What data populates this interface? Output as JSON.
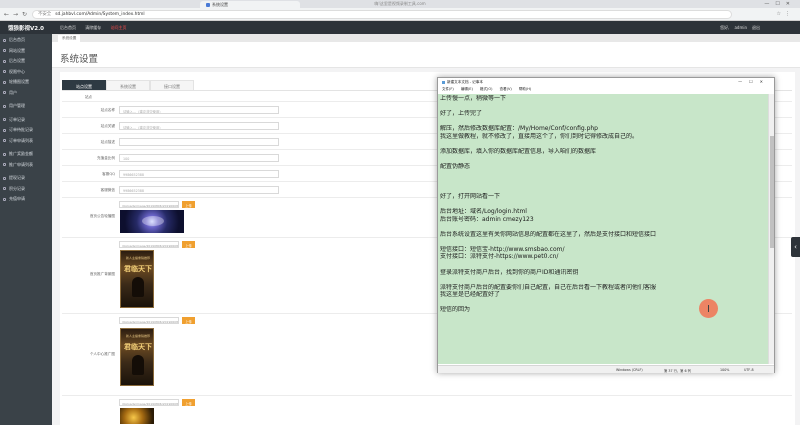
{
  "browser": {
    "tab_title": "系统设置",
    "window_title": "嗨!这里是视频录制工具.com",
    "security_label": "不安全",
    "url": "sd.jahbvl.com/Admin/System_index.html"
  },
  "header": {
    "app_title": "饿狼影视V2.0",
    "nav": [
      "后台首页",
      "清除缓存",
      "访问主页"
    ],
    "user_label": "您好,",
    "user_name": "admin",
    "logout": "退出"
  },
  "sidebar": {
    "items": [
      {
        "label": "后台首页"
      },
      {
        "label": "网站设置"
      },
      {
        "label": "后台设置"
      },
      {
        "label": "权限中心"
      },
      {
        "label": "轮播图设置"
      },
      {
        "label": "用户"
      },
      {
        "label": "用户管理"
      },
      {
        "label": "订单记录"
      },
      {
        "label": "订单待批记录"
      },
      {
        "label": "订单申请列表"
      },
      {
        "label": "推广奖励金额"
      },
      {
        "label": "推广申请列表"
      },
      {
        "label": "提现记录"
      },
      {
        "label": "积分记录"
      },
      {
        "label": "充值申请"
      }
    ]
  },
  "breadcrumb": "系统设置",
  "page_title": "系统设置",
  "tabs": [
    {
      "label": "站点设置",
      "active": true
    },
    {
      "label": "系统设置",
      "active": false
    },
    {
      "label": "接口设置",
      "active": false
    }
  ],
  "form": {
    "section_label": "站点",
    "fields": [
      {
        "label": "站点名称",
        "placeholder": "请输入…（建议非空使用）"
      },
      {
        "label": "站点关键",
        "placeholder": "请输入…（建议非空使用）"
      },
      {
        "label": "站点描述",
        "placeholder": ""
      },
      {
        "label": "充值金比例",
        "placeholder": "100"
      },
      {
        "label": "客服QQ",
        "placeholder": "9986652388"
      },
      {
        "label": "客服微信",
        "placeholder": "9986652388"
      }
    ],
    "uploads": [
      {
        "label": "首页公告轮播图",
        "path": "/Uploads/image/20190806/201906081…",
        "button": "上传"
      },
      {
        "label": "首页推广背景图",
        "path": "/Uploads/image/20190806/201906081…",
        "button": "上传"
      },
      {
        "label": "个人中心推广图",
        "path": "/Uploads/image/20190806/201906081…",
        "button": "上传"
      },
      {
        "label": "",
        "path": "/Uploads/image/20190806/201906081…",
        "button": "上传"
      }
    ],
    "poster_title": "君临天下",
    "poster_subtitle": "新人主播重磅推荐"
  },
  "notepad": {
    "title": "新建文本文档 - 记事本",
    "menu": [
      "文件(F)",
      "编辑(E)",
      "格式(O)",
      "查看(V)",
      "帮助(H)"
    ],
    "lines": [
      "上传慢一点，稍微等一下",
      "",
      "好了，上传完了",
      "",
      "解压，然后修改数据库配置：/My/Home/Conf/config.php",
      "我这里做教程，就不修改了，直接用这个了，你们到时记得修改成自己的。",
      "",
      "添加数据库，填入你的数据库配置信息，导入咱们的数据库",
      "",
      "配置伪静态",
      "",
      "",
      "",
      "好了，打开网站看一下",
      "",
      "后台地址：域名/Log/login.html",
      "后台账号密码：admin  cmezy123",
      "",
      "后台系统设置这里有关你网站信息的配置都在这里了，然后是支付接口和短信接口",
      "",
      "短信接口：短信宝-http://www.smsbao.com/",
      "支付接口：派特支付-https://www.pet0.cn/",
      "",
      "登录派特支付商户后台，找到你的商户ID和通讯密钥",
      "",
      "派特支付商户后台的配置要你们自己配置，自己在后台看一下教程或者问他们客服",
      "我这里是已经配置好了",
      "",
      "短信的回为"
    ],
    "status": {
      "encoding": "Windows (CRLF)",
      "position": "第 37 行，第 6 列",
      "zoom": "100%",
      "charset": "UTF-8"
    }
  },
  "colors": {
    "sidebar_bg": "#3a4248",
    "header_bg": "#2d3339",
    "notepad_bg": "#c8e6c9",
    "accent_upload": "#f0a030",
    "alert_red": "#ff4d4d",
    "cursor_marker": "#f07a5a"
  }
}
